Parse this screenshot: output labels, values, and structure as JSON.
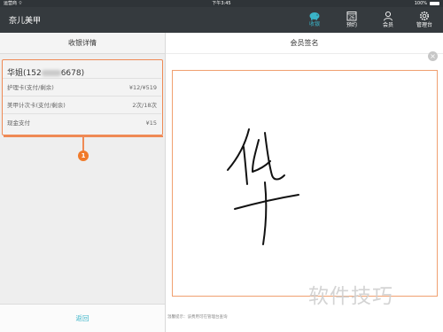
{
  "status_bar": {
    "carrier": "运营商 ⌔",
    "time": "下午3:45",
    "battery": "100%"
  },
  "app": {
    "title": "奈儿美甲"
  },
  "nav": {
    "items": [
      {
        "label": "收银",
        "icon": "piggy-bank-icon",
        "active": true
      },
      {
        "label": "预约",
        "icon": "calendar-icon",
        "active": false,
        "calendar_day": "26"
      },
      {
        "label": "会员",
        "icon": "person-icon",
        "active": false
      },
      {
        "label": "管理台",
        "icon": "gear-icon",
        "active": false
      }
    ]
  },
  "left": {
    "header": "收银详情",
    "member": {
      "name_prefix": "华姐(152",
      "name_suffix": "6678)"
    },
    "rows": [
      {
        "label": "护理卡(支付/剩余)",
        "value": "¥12/¥519"
      },
      {
        "label": "美甲计次卡(支付/剩余)",
        "value": "2次/18次"
      },
      {
        "label": "现金支付",
        "value": "¥15"
      }
    ],
    "callout_number": "1",
    "back_label": "返回"
  },
  "right": {
    "header": "会员签名",
    "close_symbol": "×",
    "footnote": "温馨提示：该费用可在管理台查询"
  },
  "watermark": "软件技巧",
  "colors": {
    "accent": "#3ab4c8",
    "highlight": "#ef8a55",
    "navbar": "#353a3e"
  }
}
